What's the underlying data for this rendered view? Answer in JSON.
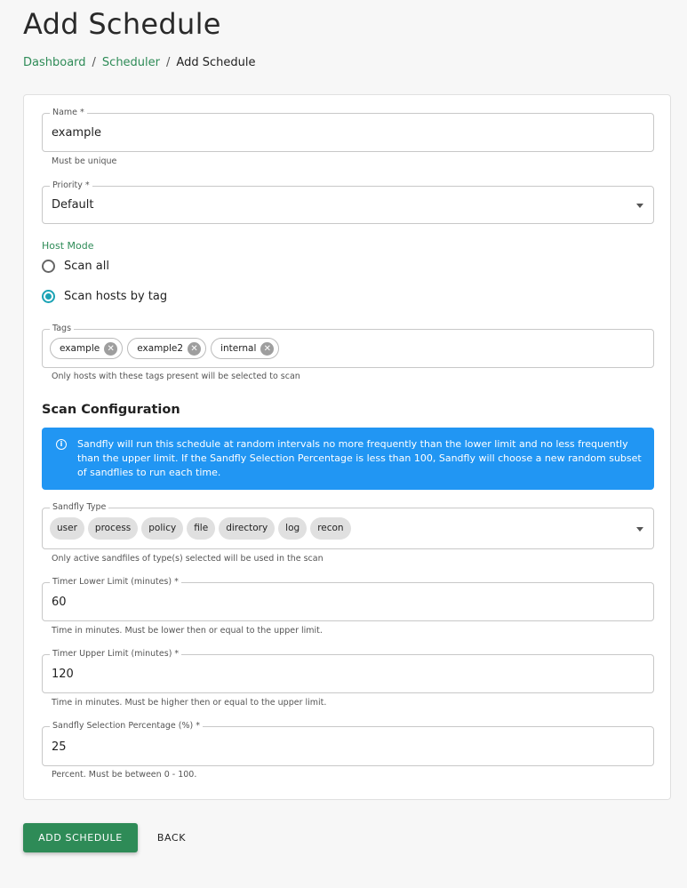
{
  "page": {
    "title": "Add Schedule",
    "breadcrumb": [
      "Dashboard",
      "Scheduler",
      "Add Schedule"
    ],
    "breadcrumb_sep": "/"
  },
  "form": {
    "name": {
      "label": "Name *",
      "value": "example",
      "helper": "Must be unique"
    },
    "priority": {
      "label": "Priority *",
      "value": "Default"
    },
    "host_mode": {
      "label": "Host Mode",
      "options": [
        {
          "label": "Scan all",
          "checked": false
        },
        {
          "label": "Scan hosts by tag",
          "checked": true
        }
      ]
    },
    "tags": {
      "label": "Tags",
      "items": [
        "example",
        "example2",
        "internal"
      ],
      "remove_icon": "close-circle-icon",
      "helper": "Only hosts with these tags present will be selected to scan"
    },
    "scan_config_heading": "Scan Configuration",
    "info_alert": "Sandfly will run this schedule at random intervals no more frequently than the lower limit and no less frequently than the upper limit. If the Sandfly Selection Percentage is less than 100, Sandfly will choose a new random subset of sandflies to run each time.",
    "sandfly_type": {
      "label": "Sandfly Type",
      "items": [
        "user",
        "process",
        "policy",
        "file",
        "directory",
        "log",
        "recon"
      ],
      "helper": "Only active sandfiles of type(s) selected will be used in the scan"
    },
    "timer_lower": {
      "label": "Timer Lower Limit (minutes) *",
      "value": "60",
      "helper": "Time in minutes. Must be lower then or equal to the upper limit."
    },
    "timer_upper": {
      "label": "Timer Upper Limit (minutes) *",
      "value": "120",
      "helper": "Time in minutes. Must be higher then or equal to the upper limit."
    },
    "selection_pct": {
      "label": "Sandfly Selection Percentage (%) *",
      "value": "25",
      "helper": "Percent. Must be between 0 - 100."
    }
  },
  "actions": {
    "submit": "ADD SCHEDULE",
    "back": "BACK"
  },
  "colors": {
    "accent": "#2e8b57",
    "radio": "#1ba3b5",
    "info": "#2196f3"
  }
}
